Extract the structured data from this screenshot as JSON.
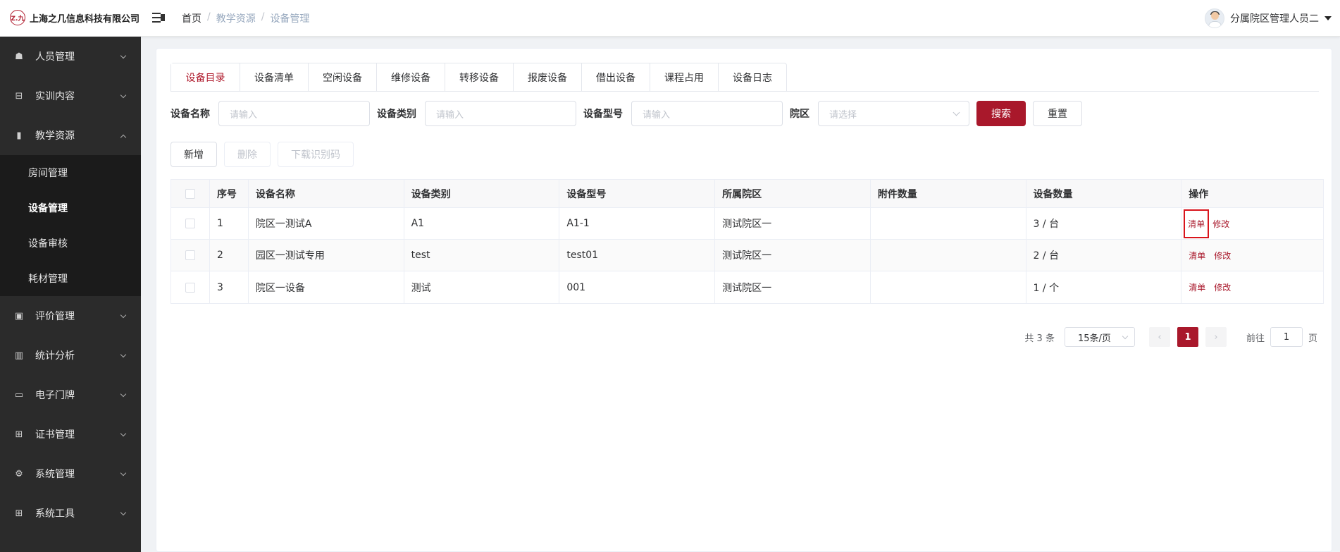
{
  "header": {
    "logo_mark": "Z.九",
    "company": "上海之几信息科技有限公司",
    "breadcrumb": [
      "首页",
      "教学资源",
      "设备管理"
    ],
    "breadcrumb_sep": "/",
    "user_name": "分属院区管理人员二"
  },
  "sidebar": {
    "items": [
      {
        "label": "人员管理",
        "icon": "person-icon",
        "glyph": "☗"
      },
      {
        "label": "实训内容",
        "icon": "training-icon",
        "glyph": "⊟"
      },
      {
        "label": "教学资源",
        "icon": "resource-icon",
        "glyph": "▮",
        "expanded": true
      },
      {
        "label": "评价管理",
        "icon": "evaluate-icon",
        "glyph": "▣"
      },
      {
        "label": "统计分析",
        "icon": "bar-chart-icon",
        "glyph": "▥"
      },
      {
        "label": "电子门牌",
        "icon": "monitor-icon",
        "glyph": "▭"
      },
      {
        "label": "证书管理",
        "icon": "briefcase-icon",
        "glyph": "⊞"
      },
      {
        "label": "系统管理",
        "icon": "gear-icon",
        "glyph": "⚙"
      },
      {
        "label": "系统工具",
        "icon": "toolbox-icon",
        "glyph": "⊞"
      }
    ],
    "subitems": [
      "房间管理",
      "设备管理",
      "设备审核",
      "耗材管理"
    ],
    "active_subitem": "设备管理"
  },
  "tabs": [
    "设备目录",
    "设备清单",
    "空闲设备",
    "维修设备",
    "转移设备",
    "报废设备",
    "借出设备",
    "课程占用",
    "设备日志"
  ],
  "active_tab": "设备目录",
  "filters": {
    "name_label": "设备名称",
    "name_placeholder": "请输入",
    "type_label": "设备类别",
    "type_placeholder": "请输入",
    "model_label": "设备型号",
    "model_placeholder": "请输入",
    "campus_label": "院区",
    "campus_placeholder": "请选择",
    "search": "搜索",
    "reset": "重置"
  },
  "actions": {
    "add": "新增",
    "delete": "删除",
    "download": "下载识别码"
  },
  "table": {
    "columns": [
      "序号",
      "设备名称",
      "设备类别",
      "设备型号",
      "所属院区",
      "附件数量",
      "设备数量",
      "操作"
    ],
    "rows": [
      {
        "index": "1",
        "name": "院区一测试A",
        "type": "A1",
        "model": "A1-1",
        "campus": "测试院区一",
        "attachments": "",
        "count": "3 / 台"
      },
      {
        "index": "2",
        "name": "园区一测试专用",
        "type": "test",
        "model": "test01",
        "campus": "测试院区一",
        "attachments": "",
        "count": "2 / 台"
      },
      {
        "index": "3",
        "name": "院区一设备",
        "type": "测试",
        "model": "001",
        "campus": "测试院区一",
        "attachments": "",
        "count": "1 / 个"
      }
    ],
    "op_list": "清单",
    "op_edit": "修改"
  },
  "pagination": {
    "total": "共 3 条",
    "page_size": "15条/页",
    "current_page": "1",
    "goto_prefix": "前往",
    "goto_value": "1",
    "goto_suffix": "页",
    "prev": "‹",
    "next": "›"
  },
  "colors": {
    "accent": "#a9182b",
    "sidebar_bg": "#2b2b2b",
    "submenu_bg": "#1b1b1b"
  }
}
